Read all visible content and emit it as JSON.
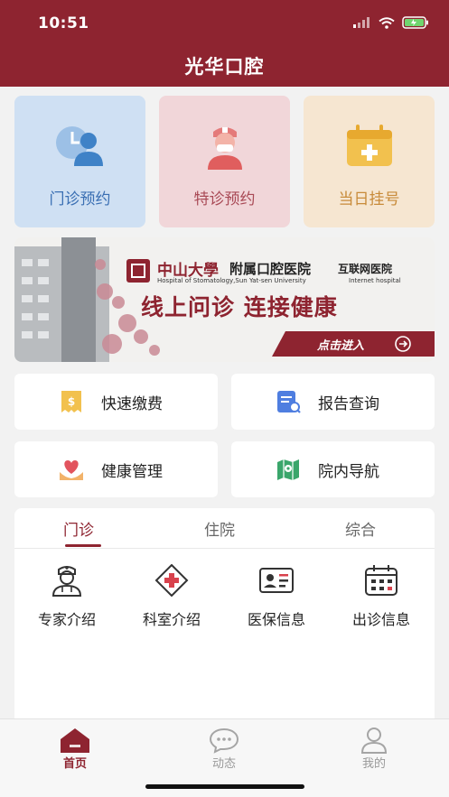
{
  "status_bar": {
    "time": "10:51"
  },
  "header": {
    "title": "光华口腔"
  },
  "cards": [
    {
      "label": "门诊预约",
      "icon": "clinic-consult-icon",
      "bg": "#cfe0f3",
      "color": "#3a6fb3"
    },
    {
      "label": "特诊预约",
      "icon": "nurse-icon",
      "bg": "#f1d6d9",
      "color": "#a94a56"
    },
    {
      "label": "当日挂号",
      "icon": "medical-kit-icon",
      "bg": "#f6e6d1",
      "color": "#c88b3a"
    }
  ],
  "banner": {
    "school": "中山大學",
    "hospital": "附属口腔医院",
    "internet_hospital_cn": "互联网医院",
    "en_name": "Hospital of Stomatology,Sun Yat-sen University",
    "en_internet": "Internet hospital",
    "slogan": "线上问诊 连接健康",
    "cta": "点击进入"
  },
  "quick_tiles": [
    {
      "label": "快速缴费",
      "icon": "payment-receipt-icon"
    },
    {
      "label": "报告查询",
      "icon": "report-search-icon"
    },
    {
      "label": "健康管理",
      "icon": "heart-hands-icon"
    },
    {
      "label": "院内导航",
      "icon": "map-navigation-icon"
    }
  ],
  "tabs": [
    {
      "label": "门诊",
      "active": true
    },
    {
      "label": "住院",
      "active": false
    },
    {
      "label": "综合",
      "active": false
    }
  ],
  "services": [
    {
      "label": "专家介绍",
      "icon": "doctor-icon"
    },
    {
      "label": "科室介绍",
      "icon": "medical-cross-icon"
    },
    {
      "label": "医保信息",
      "icon": "insurance-card-icon"
    },
    {
      "label": "出诊信息",
      "icon": "calendar-icon"
    }
  ],
  "bottom_nav": [
    {
      "label": "首页",
      "icon": "home-icon",
      "active": true
    },
    {
      "label": "动态",
      "icon": "chat-bubble-icon",
      "active": false
    },
    {
      "label": "我的",
      "icon": "profile-icon",
      "active": false
    }
  ],
  "colors": {
    "brand": "#8e2430",
    "background": "#f2f2f2"
  }
}
